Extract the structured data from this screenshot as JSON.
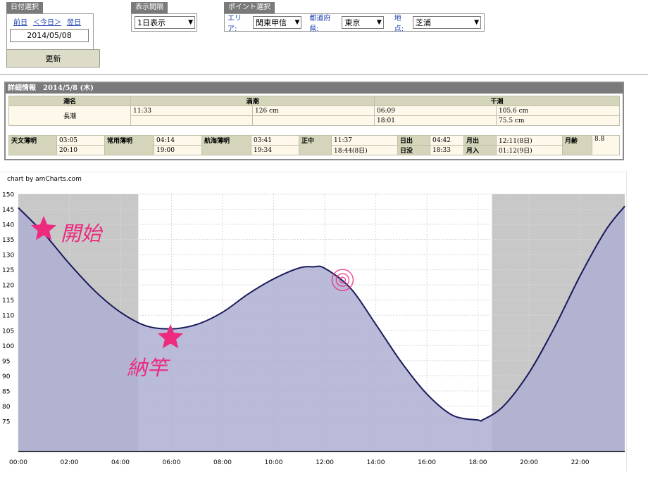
{
  "date_panel": {
    "title": "日付選択",
    "prev": "前日",
    "today": "＜今日＞",
    "next": "翌日",
    "date_value": "2014/05/08"
  },
  "update_button": "更新",
  "interval_panel": {
    "title": "表示間隔",
    "selected": "1日表示"
  },
  "point_panel": {
    "title": "ポイント選択",
    "area_label": "エリア:",
    "area_value": "関東甲信",
    "pref_label": "都道府県:",
    "pref_value": "東京",
    "spot_label": "地点:",
    "spot_value": "芝浦"
  },
  "detail": {
    "title": "詳細情報　2014/5/8 (木)",
    "tide_name_header": "潮名",
    "high_header": "満潮",
    "low_header": "干潮",
    "tide_name": "長潮",
    "high": [
      {
        "time": "11:33",
        "level": "126 cm"
      }
    ],
    "low": [
      {
        "time": "06:09",
        "level": "105.6 cm"
      },
      {
        "time": "18:01",
        "level": "75.5 cm"
      }
    ],
    "astro": [
      {
        "label": "天文薄明",
        "v1": "03:05",
        "v2": "20:10"
      },
      {
        "label": "常用薄明",
        "v1": "04:14",
        "v2": "19:00"
      },
      {
        "label": "航海薄明",
        "v1": "03:41",
        "v2": "19:34"
      },
      {
        "label": "正中",
        "v1": "11:37",
        "v2": "18:44(8日)"
      }
    ],
    "sun_rise_label": "日出",
    "sun_rise": "04:42",
    "sun_set_label": "日没",
    "sun_set": "18:33",
    "moon_rise_label": "月出",
    "moon_rise": "12:11(8日)",
    "moon_set_label": "月入",
    "moon_set": "01:12(9日)",
    "moon_age_label": "月齢",
    "moon_age": "8.8"
  },
  "chart_credit": "chart by amCharts.com",
  "annotations": {
    "start": "開始",
    "nou": "納竿"
  },
  "chart_data": {
    "type": "area",
    "x_ticks": [
      "00:00",
      "02:00",
      "04:00",
      "06:00",
      "08:00",
      "10:00",
      "12:00",
      "14:00",
      "16:00",
      "18:00",
      "20:00",
      "22:00"
    ],
    "y_ticks": [
      75,
      80,
      85,
      90,
      95,
      100,
      105,
      110,
      115,
      120,
      125,
      130,
      135,
      140,
      145,
      150
    ],
    "ylim": [
      65,
      150
    ],
    "xlim_hours": [
      0,
      23.75
    ],
    "series": [
      {
        "x_hours": [
          0,
          1,
          2,
          3,
          4,
          5,
          6,
          7,
          8,
          9,
          10,
          11,
          11.55,
          12,
          13,
          14,
          15,
          16,
          17,
          18,
          18.2,
          19,
          20,
          21,
          22,
          23,
          23.75
        ],
        "values": [
          145.5,
          137,
          127,
          118,
          111,
          106.5,
          105.5,
          107,
          111,
          117,
          122,
          125.6,
          126,
          125.5,
          119,
          107,
          94.5,
          84,
          77,
          75.4,
          75.5,
          80,
          91,
          106,
          123,
          138,
          146
        ]
      }
    ],
    "night_bands_hours": [
      [
        0,
        4.7
      ],
      [
        18.55,
        23.75
      ]
    ],
    "marker_hour": 12.7,
    "colors": {
      "fill": "#aeaed2",
      "line": "#1a1a5c",
      "night": "#c8c8c8",
      "annot": "#ec2a7e"
    }
  }
}
